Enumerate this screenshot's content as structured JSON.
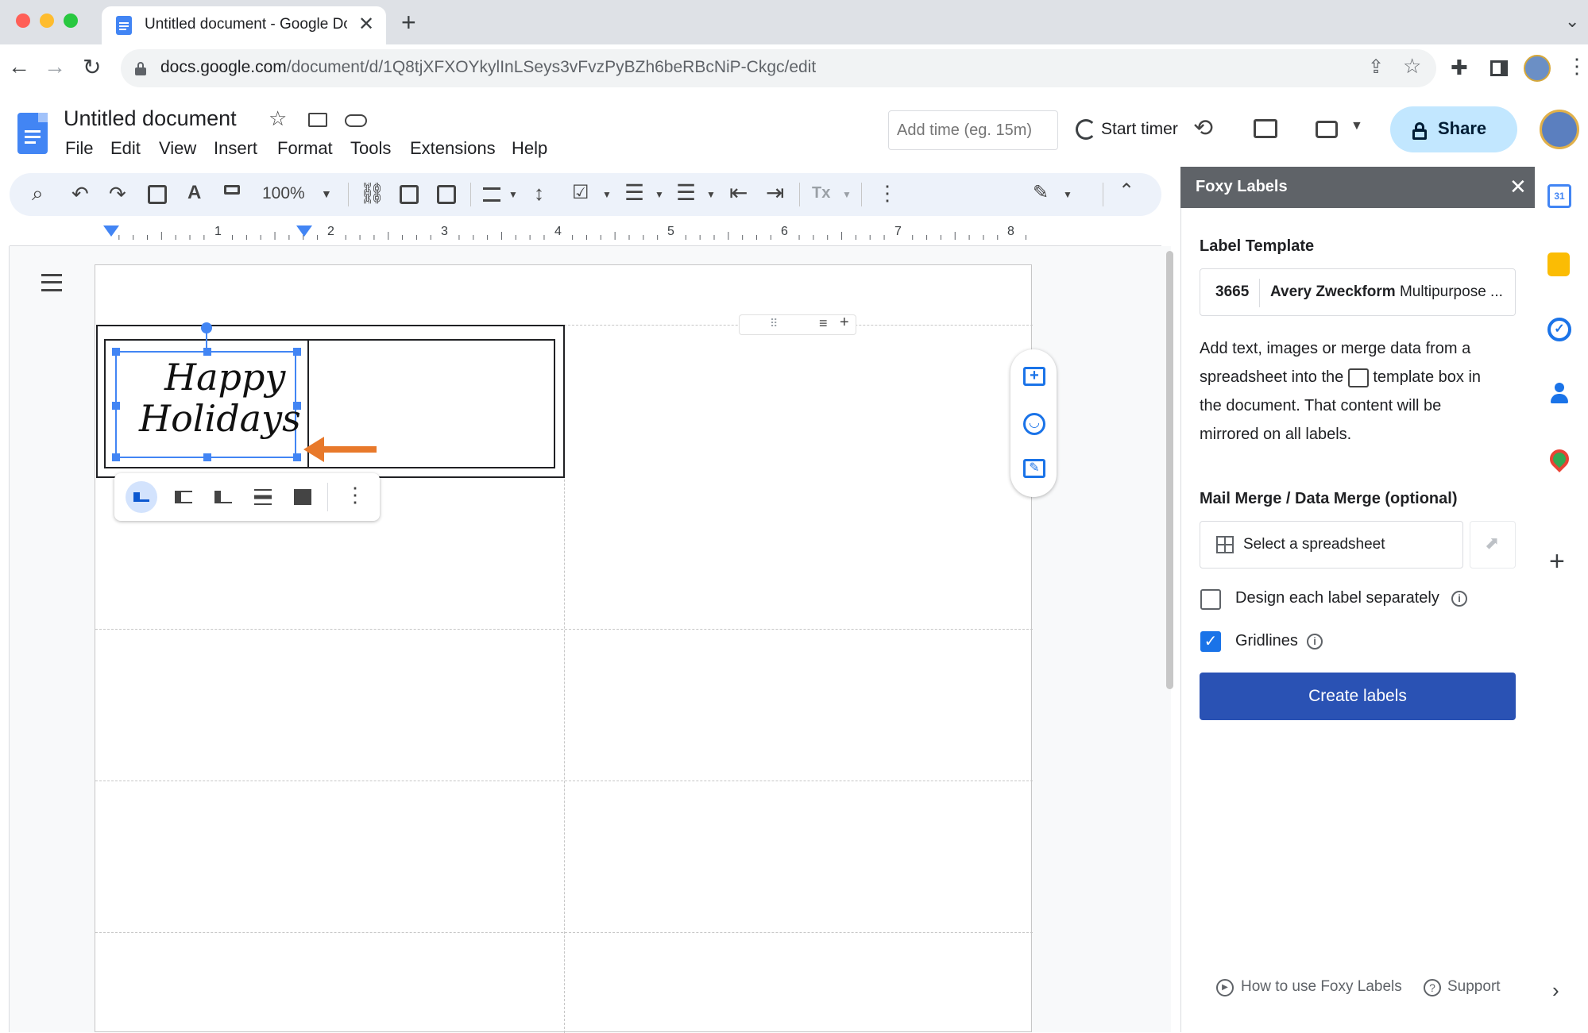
{
  "browser": {
    "tab_title": "Untitled document - Google Dc",
    "url_host": "docs.google.com",
    "url_path": "/document/d/1Q8tjXFXOYkylInLSeys3vFvzPyBZh6beRBcNiP-Ckgc/edit"
  },
  "docs": {
    "title": "Untitled document",
    "menus": [
      "File",
      "Edit",
      "View",
      "Insert",
      "Format",
      "Tools",
      "Extensions",
      "Help"
    ],
    "add_time_placeholder": "Add time (eg. 15m)",
    "start_timer": "Start timer",
    "share": "Share",
    "zoom": "100%",
    "ruler_marks": [
      "1",
      "2",
      "3",
      "4",
      "5",
      "6",
      "7",
      "8"
    ]
  },
  "image": {
    "line1": "Happy",
    "line2": "Holidays"
  },
  "panel": {
    "title": "Foxy Labels",
    "label_template_heading": "Label Template",
    "template_code": "3665",
    "template_name_bold": "Avery Zweckform",
    "template_name_rest": "Multipurpose ...",
    "desc_1": "Add text, images or merge data from a",
    "desc_2a": "spreadsheet into the",
    "desc_2b": "template box in",
    "desc_3": "the document. That content will be",
    "desc_4": "mirrored on all labels.",
    "merge_heading": "Mail Merge / Data Merge (optional)",
    "select_spreadsheet": "Select a spreadsheet",
    "design_separately": "Design each label separately",
    "design_separately_checked": false,
    "gridlines": "Gridlines",
    "gridlines_checked": true,
    "create_labels": "Create labels",
    "how_to": "How to use Foxy Labels",
    "support": "Support"
  },
  "colors": {
    "accent_blue": "#1a73e8",
    "create_button": "#2a52b4",
    "arrow_orange": "#e8792b",
    "panel_header": "#5f6368",
    "share_bg": "#c2e7ff"
  }
}
